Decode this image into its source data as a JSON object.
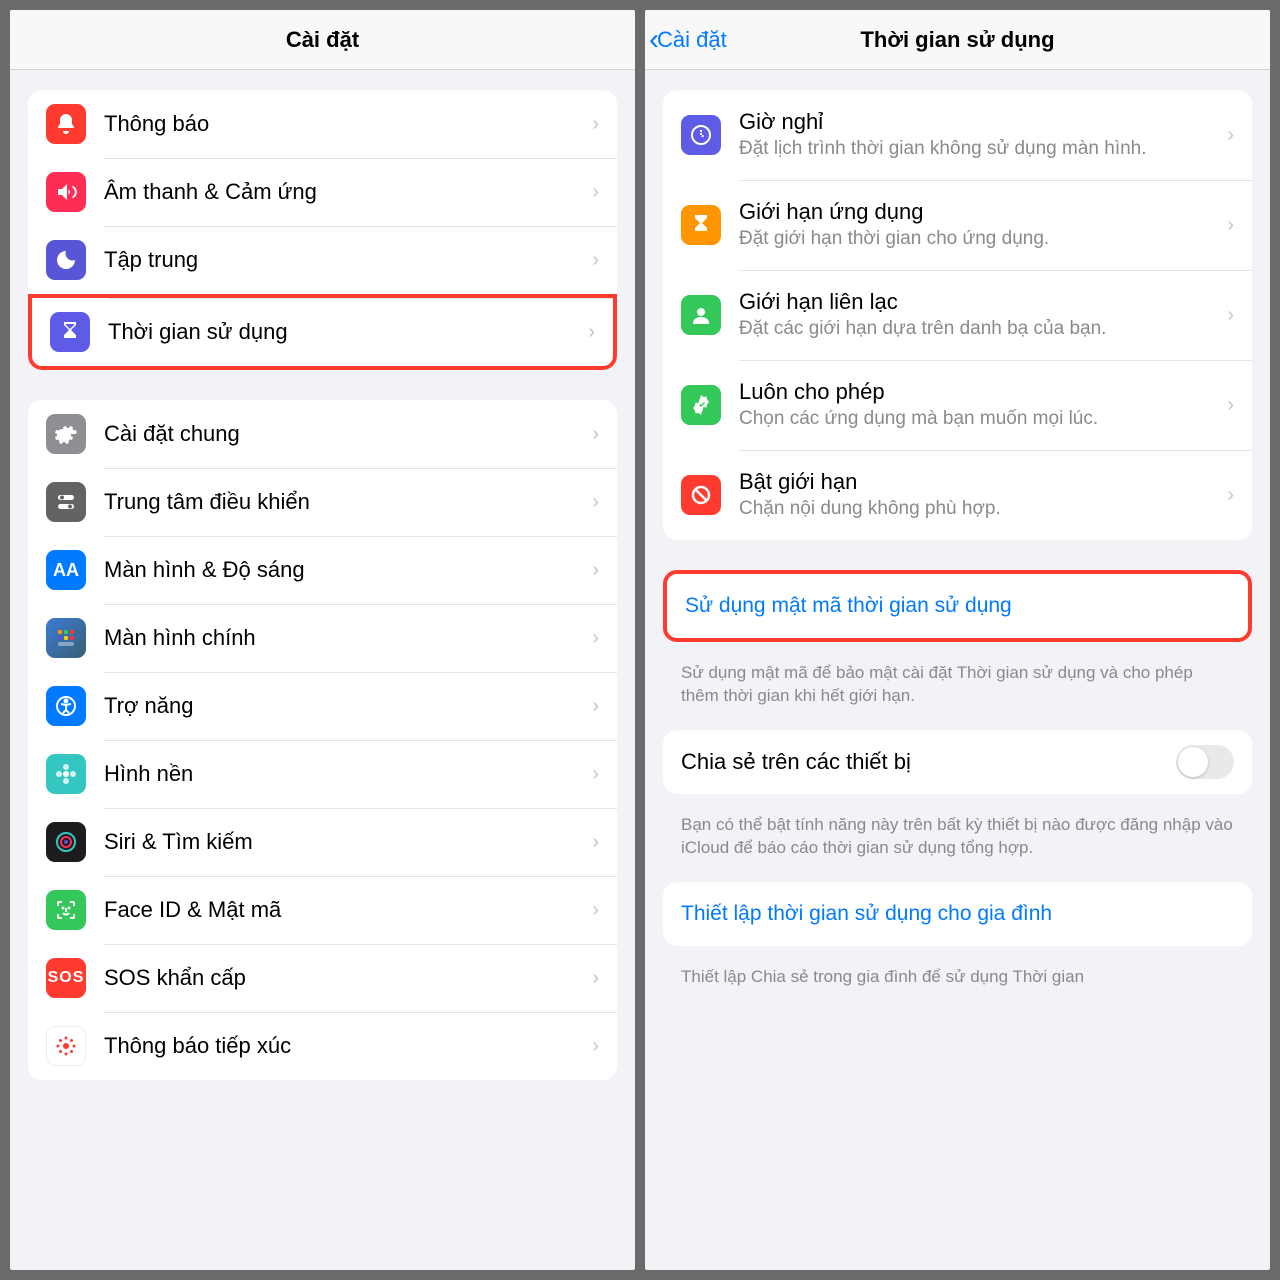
{
  "left": {
    "title": "Cài đặt",
    "group1": [
      {
        "key": "notifications",
        "label": "Thông báo",
        "icon": "bell",
        "bg": "bg-red"
      },
      {
        "key": "sounds",
        "label": "Âm thanh & Cảm ứng",
        "icon": "speaker",
        "bg": "bg-pink"
      },
      {
        "key": "focus",
        "label": "Tập trung",
        "icon": "moon",
        "bg": "bg-indigo"
      },
      {
        "key": "screentime",
        "label": "Thời gian sử dụng",
        "icon": "hourglass",
        "bg": "bg-purple",
        "highlighted": true
      }
    ],
    "group2": [
      {
        "key": "general",
        "label": "Cài đặt chung",
        "icon": "gear",
        "bg": "bg-gray"
      },
      {
        "key": "control-center",
        "label": "Trung tâm điều khiển",
        "icon": "switches",
        "bg": "bg-darkgray"
      },
      {
        "key": "display",
        "label": "Màn hình & Độ sáng",
        "icon": "aa",
        "bg": "bg-blue"
      },
      {
        "key": "home-screen",
        "label": "Màn hình chính",
        "icon": "grid",
        "bg": "bg-home"
      },
      {
        "key": "accessibility",
        "label": "Trợ năng",
        "icon": "accessibility",
        "bg": "bg-blue"
      },
      {
        "key": "wallpaper",
        "label": "Hình nền",
        "icon": "flower",
        "bg": "bg-teal"
      },
      {
        "key": "siri",
        "label": "Siri & Tìm kiếm",
        "icon": "siri",
        "bg": "bg-black"
      },
      {
        "key": "faceid",
        "label": "Face ID & Mật mã",
        "icon": "face",
        "bg": "bg-green"
      },
      {
        "key": "sos",
        "label": "SOS khẩn cấp",
        "icon": "sos",
        "bg": "bg-sos"
      },
      {
        "key": "exposure",
        "label": "Thông báo tiếp xúc",
        "icon": "exposure",
        "bg": "bg-exposure"
      }
    ]
  },
  "right": {
    "back": "Cài đặt",
    "title": "Thời gian sử dụng",
    "options": [
      {
        "key": "downtime",
        "title": "Giờ nghỉ",
        "sub": "Đặt lịch trình thời gian không sử dụng màn hình.",
        "icon": "clock",
        "bg": "bg-purple"
      },
      {
        "key": "app-limits",
        "title": "Giới hạn ứng dụng",
        "sub": "Đặt giới hạn thời gian cho ứng dụng.",
        "icon": "hourglass",
        "bg": "bg-orange"
      },
      {
        "key": "comm-limits",
        "title": "Giới hạn liên lạc",
        "sub": "Đặt các giới hạn dựa trên danh bạ của bạn.",
        "icon": "contact",
        "bg": "bg-green"
      },
      {
        "key": "always-allowed",
        "title": "Luôn cho phép",
        "sub": "Chọn các ứng dụng mà bạn muốn mọi lúc.",
        "icon": "check",
        "bg": "bg-green"
      },
      {
        "key": "restrictions",
        "title": "Bật giới hạn",
        "sub": "Chặn nội dung không phù hợp.",
        "icon": "restrict",
        "bg": "bg-red"
      }
    ],
    "passcode_link": "Sử dụng mật mã thời gian sử dụng",
    "passcode_footer": "Sử dụng mật mã để bảo mật cài đặt Thời gian sử dụng và cho phép thêm thời gian khi hết giới hạn.",
    "share_label": "Chia sẻ trên các thiết bị",
    "share_footer": "Bạn có thể bật tính năng này trên bất kỳ thiết bị nào được đăng nhập vào iCloud để báo cáo thời gian sử dụng tổng hợp.",
    "family_link": "Thiết lập thời gian sử dụng cho gia đình",
    "family_footer": "Thiết lập Chia sẻ trong gia đình để sử dụng Thời gian"
  }
}
